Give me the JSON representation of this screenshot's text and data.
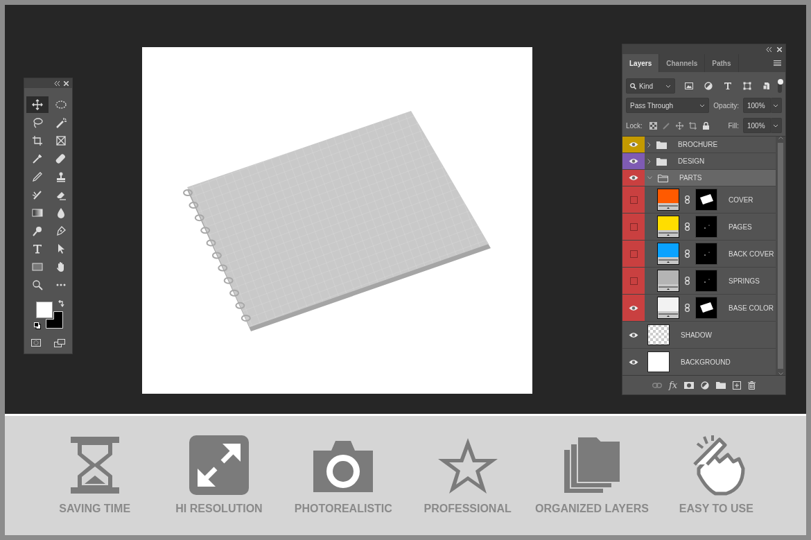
{
  "toolbox": {
    "tools": [
      {
        "selected": true
      },
      {
        "selected": false
      },
      {
        "selected": false
      },
      {
        "selected": false
      },
      {
        "selected": false
      },
      {
        "selected": false
      },
      {
        "selected": false
      },
      {
        "selected": false
      },
      {
        "selected": false
      },
      {
        "selected": false
      },
      {
        "selected": false
      },
      {
        "selected": false
      },
      {
        "selected": false
      },
      {
        "selected": false
      },
      {
        "selected": false
      },
      {
        "selected": false
      },
      {
        "selected": false
      },
      {
        "selected": false
      },
      {
        "selected": false
      },
      {
        "selected": false
      },
      {
        "selected": false
      },
      {
        "selected": false
      }
    ]
  },
  "layers_panel": {
    "tabs": [
      {
        "label": "Layers",
        "selected": true
      },
      {
        "label": "Channels",
        "selected": false
      },
      {
        "label": "Paths",
        "selected": false
      }
    ],
    "filter": "Kind",
    "blend_mode": "Pass Through",
    "opacity_label": "Opacity:",
    "opacity": "100%",
    "lock_label": "Lock:",
    "fill_label": "Fill:",
    "fill": "100%",
    "layers": [
      {
        "name": "BROCHURE",
        "kind": "group",
        "color": "#c49a00",
        "visible": true,
        "expanded": false,
        "selected": false
      },
      {
        "name": "DESIGN",
        "kind": "group",
        "color": "#7e5bb3",
        "visible": true,
        "expanded": false,
        "selected": false
      },
      {
        "name": "PARTS",
        "kind": "group",
        "color": "#c94040",
        "visible": true,
        "expanded": true,
        "selected": true,
        "children": [
          {
            "name": "COVER",
            "kind": "fill",
            "color": "#c94040",
            "thumbnail": {
              "color": "#ff5a00"
            },
            "mask_shape": true,
            "visible": false,
            "selected": false
          },
          {
            "name": "PAGES",
            "kind": "fill",
            "color": "#c94040",
            "thumbnail": {
              "color": "#ffdd00"
            },
            "mask_shape": false,
            "visible": false,
            "selected": false
          },
          {
            "name": "BACK COVER",
            "kind": "fill",
            "color": "#c94040",
            "thumbnail": {
              "color": "#0aa2ff"
            },
            "mask_shape": false,
            "visible": false,
            "selected": false
          },
          {
            "name": "SPRINGS",
            "kind": "fill",
            "color": "#c94040",
            "thumbnail": {
              "color": "#b4b4b4"
            },
            "mask_shape": false,
            "visible": false,
            "selected": false
          },
          {
            "name": "BASE COLOR",
            "kind": "fill",
            "color": "#c94040",
            "thumbnail": {
              "color": "#f2f2f2"
            },
            "mask_shape": true,
            "visible": true,
            "selected": false
          }
        ]
      },
      {
        "name": "SHADOW",
        "kind": "pixel",
        "visible": true,
        "selected": false
      },
      {
        "name": "BACKGROUND",
        "kind": "background",
        "visible": true,
        "selected": false
      }
    ],
    "footer_fx": "fx"
  },
  "features": [
    {
      "label": "SAVING TIME"
    },
    {
      "label": "HI RESOLUTION"
    },
    {
      "label": "PHOTOREALISTIC"
    },
    {
      "label": "PROFESSIONAL"
    },
    {
      "label": "ORGANIZED LAYERS"
    },
    {
      "label": "EASY TO USE"
    }
  ]
}
